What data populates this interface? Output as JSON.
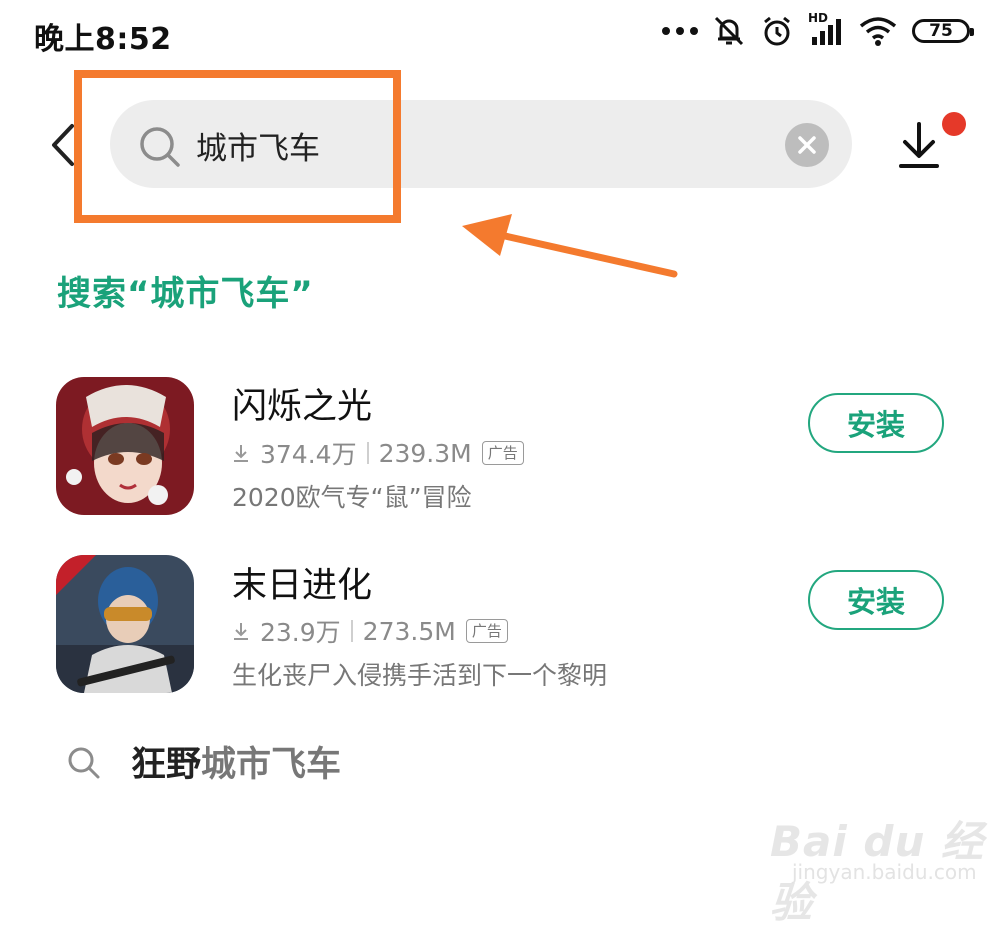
{
  "status_bar": {
    "time": "晚上8:52",
    "battery": "75",
    "signal_label": "HD"
  },
  "search": {
    "query": "城市飞车"
  },
  "suggestion": "搜索“城市飞车”",
  "apps": [
    {
      "name": "闪烁之光",
      "downloads": "374.4万",
      "size": "239.3M",
      "ad_label": "广告",
      "desc": "2020欧气专“鼠”冒险",
      "install_label": "安装"
    },
    {
      "name": "末日进化",
      "downloads": "23.9万",
      "size": "273.5M",
      "ad_label": "广告",
      "desc": "生化丧尸入侵携手活到下一个黎明",
      "install_label": "安装"
    }
  ],
  "related": {
    "prefix": "狂野",
    "term": "城市飞车"
  },
  "watermark": {
    "main": "Bai du 经验",
    "sub": "jingyan.baidu.com"
  },
  "colors": {
    "accent": "#1aa27a",
    "annotation": "#f47a2e",
    "notification": "#e53929"
  }
}
